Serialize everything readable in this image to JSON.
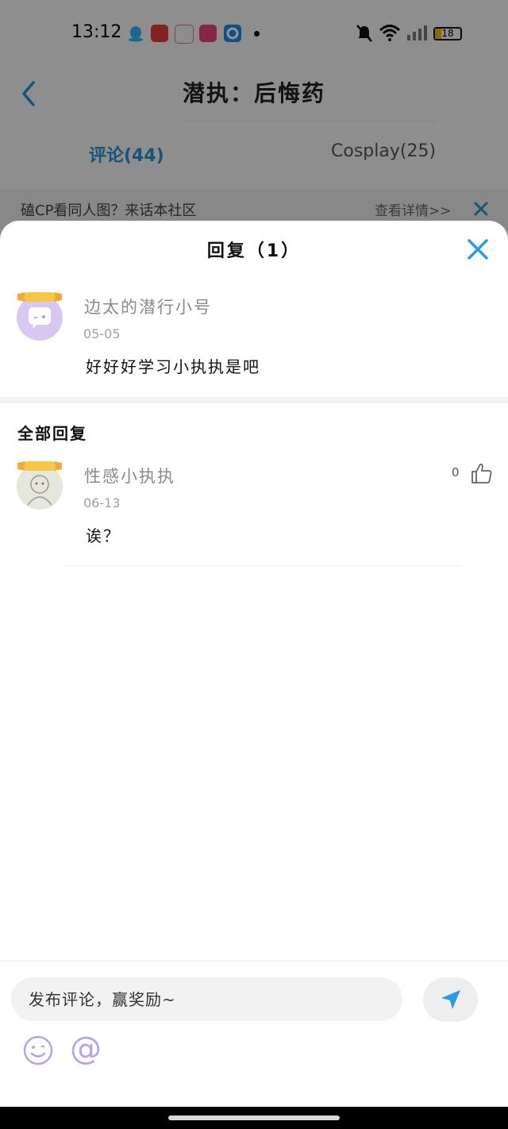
{
  "status_bar": {
    "time": "13:12",
    "battery": "18"
  },
  "header": {
    "title": "潜执：后悔药",
    "tabs": [
      {
        "label": "评论(44)",
        "active": true
      },
      {
        "label": "Cosplay(25)",
        "active": false
      }
    ]
  },
  "banner": {
    "text": "磕CP看同人图？来话本社区",
    "link": "查看详情>>"
  },
  "sheet": {
    "title": "回复（1）",
    "original_comment": {
      "username": "边太的潜行小号",
      "date": "05-05",
      "content": "好好好学习小执执是吧"
    },
    "section_title": "全部回复",
    "replies": [
      {
        "username": "性感小执执",
        "date": "06-13",
        "content": "诶？",
        "likes": "0"
      }
    ]
  },
  "input_bar": {
    "placeholder": "发布评论，赢奖励~",
    "at_symbol": "@"
  },
  "colors": {
    "accent": "#2b8fd3",
    "close_icon": "#2a9be6",
    "send_icon": "#2a9be6"
  }
}
